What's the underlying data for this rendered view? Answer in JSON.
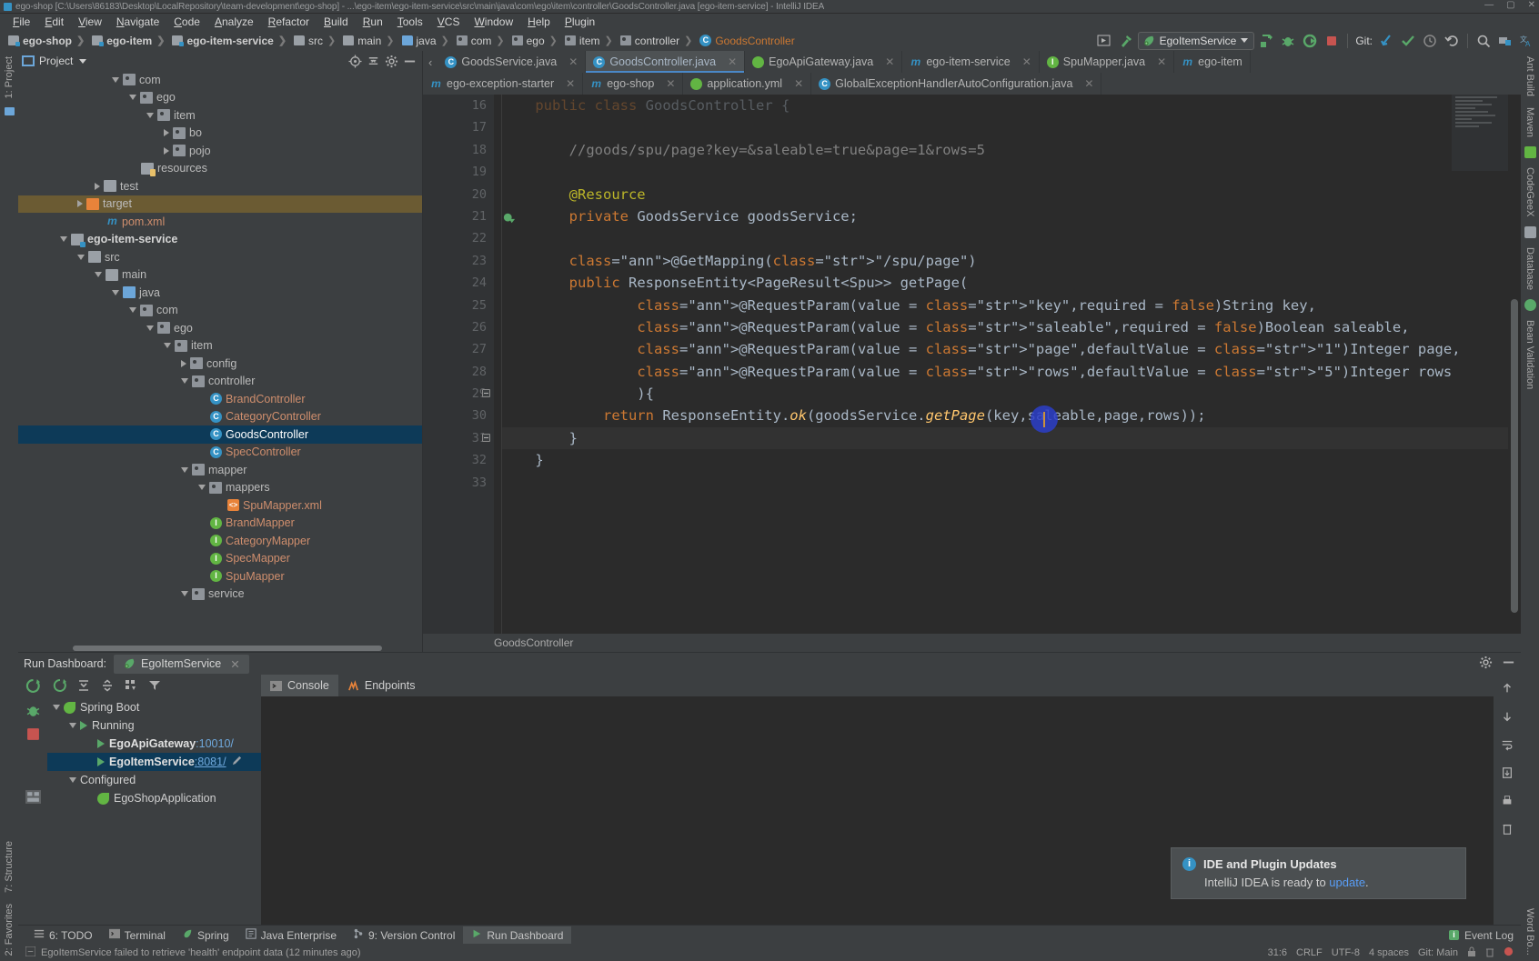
{
  "window": {
    "title": "ego-shop [C:\\Users\\86183\\Desktop\\LocalRepository\\team-development\\ego-shop] - ...\\ego-item\\ego-item-service\\src\\main\\java\\com\\ego\\item\\controller\\GoodsController.java [ego-item-service] - IntelliJ IDEA",
    "minimize": "—",
    "maximize": "▢",
    "close": "✕"
  },
  "menu": [
    "File",
    "Edit",
    "View",
    "Navigate",
    "Code",
    "Analyze",
    "Refactor",
    "Build",
    "Run",
    "Tools",
    "VCS",
    "Window",
    "Help",
    "Plugin"
  ],
  "breadcrumb": [
    {
      "label": "ego-shop",
      "icon": "module-folder-icon",
      "bold": true
    },
    {
      "label": "ego-item",
      "icon": "module-folder-icon",
      "bold": true
    },
    {
      "label": "ego-item-service",
      "icon": "module-folder-icon",
      "bold": true
    },
    {
      "label": "src",
      "icon": "folder-icon",
      "bold": false
    },
    {
      "label": "main",
      "icon": "folder-icon",
      "bold": false
    },
    {
      "label": "java",
      "icon": "source-folder-icon",
      "bold": false
    },
    {
      "label": "com",
      "icon": "package-icon",
      "bold": false
    },
    {
      "label": "ego",
      "icon": "package-icon",
      "bold": false
    },
    {
      "label": "item",
      "icon": "package-icon",
      "bold": false
    },
    {
      "label": "controller",
      "icon": "package-icon",
      "bold": false
    },
    {
      "label": "GoodsController",
      "icon": "class-icon",
      "bold": false,
      "active": true
    }
  ],
  "toolbar": {
    "run_config": "EgoItemService",
    "git_label": "Git:",
    "icons": [
      "preview-icon",
      "build-hammer-icon",
      "run-icon",
      "debug-icon",
      "run-coverage-icon",
      "stop-icon",
      "git-update-icon",
      "git-commit-icon",
      "git-history-icon",
      "undo-icon",
      "search-icon",
      "project-structure-icon",
      "translate-icon"
    ]
  },
  "left_strip": [
    "1: Project"
  ],
  "left_strip_bottom": [
    "7: Structure",
    "2: Favorites"
  ],
  "right_strip": [
    "Ant Build",
    "Maven",
    "CodeGeeX",
    "Database",
    "Bean Validation"
  ],
  "right_strip_bottom": [
    "Word Bo..."
  ],
  "project": {
    "title": "Project",
    "header_icons": [
      "locate-icon",
      "collapse-all-icon",
      "settings-gear-icon",
      "hide-icon"
    ],
    "tree": [
      {
        "indent": 5,
        "arrow": "down",
        "icon": "package-icon",
        "label": "com"
      },
      {
        "indent": 6,
        "arrow": "down",
        "icon": "package-icon",
        "label": "ego"
      },
      {
        "indent": 7,
        "arrow": "down",
        "icon": "package-icon",
        "label": "item"
      },
      {
        "indent": 8,
        "arrow": "right",
        "icon": "package-icon",
        "label": "bo"
      },
      {
        "indent": 8,
        "arrow": "right",
        "icon": "package-icon",
        "label": "pojo"
      },
      {
        "indent": 6,
        "arrow": "none",
        "icon": "resources-folder-icon",
        "label": "resources"
      },
      {
        "indent": 4,
        "arrow": "right",
        "icon": "folder-icon",
        "label": "test"
      },
      {
        "indent": 3,
        "arrow": "right",
        "icon": "target-folder-icon",
        "label": "target",
        "highlight": true
      },
      {
        "indent": 4,
        "arrow": "none",
        "icon": "maven-icon",
        "label": "pom.xml",
        "color": "red"
      },
      {
        "indent": 2,
        "arrow": "down",
        "icon": "module-folder-icon",
        "label": "ego-item-service",
        "bold": true
      },
      {
        "indent": 3,
        "arrow": "down",
        "icon": "folder-icon",
        "label": "src"
      },
      {
        "indent": 4,
        "arrow": "down",
        "icon": "folder-icon",
        "label": "main"
      },
      {
        "indent": 5,
        "arrow": "down",
        "icon": "source-folder-icon",
        "label": "java"
      },
      {
        "indent": 6,
        "arrow": "down",
        "icon": "package-icon",
        "label": "com"
      },
      {
        "indent": 7,
        "arrow": "down",
        "icon": "package-icon",
        "label": "ego"
      },
      {
        "indent": 8,
        "arrow": "down",
        "icon": "package-icon",
        "label": "item"
      },
      {
        "indent": 9,
        "arrow": "right",
        "icon": "package-icon",
        "label": "config"
      },
      {
        "indent": 9,
        "arrow": "down",
        "icon": "package-icon",
        "label": "controller"
      },
      {
        "indent": 10,
        "arrow": "none",
        "icon": "class-icon",
        "label": "BrandController",
        "color": "red"
      },
      {
        "indent": 10,
        "arrow": "none",
        "icon": "class-icon",
        "label": "CategoryController",
        "color": "red"
      },
      {
        "indent": 10,
        "arrow": "none",
        "icon": "class-icon",
        "label": "GoodsController",
        "selected": true
      },
      {
        "indent": 10,
        "arrow": "none",
        "icon": "class-icon",
        "label": "SpecController",
        "color": "red"
      },
      {
        "indent": 9,
        "arrow": "down",
        "icon": "package-icon",
        "label": "mapper"
      },
      {
        "indent": 10,
        "arrow": "down",
        "icon": "package-icon",
        "label": "mappers"
      },
      {
        "indent": 11,
        "arrow": "none",
        "icon": "xml-file-icon",
        "label": "SpuMapper.xml",
        "color": "red"
      },
      {
        "indent": 10,
        "arrow": "none",
        "icon": "interface-icon",
        "label": "BrandMapper",
        "color": "red"
      },
      {
        "indent": 10,
        "arrow": "none",
        "icon": "interface-icon",
        "label": "CategoryMapper",
        "color": "red"
      },
      {
        "indent": 10,
        "arrow": "none",
        "icon": "interface-icon",
        "label": "SpecMapper",
        "color": "red"
      },
      {
        "indent": 10,
        "arrow": "none",
        "icon": "interface-icon",
        "label": "SpuMapper",
        "color": "red"
      },
      {
        "indent": 9,
        "arrow": "down",
        "icon": "package-icon",
        "label": "service"
      }
    ]
  },
  "editor": {
    "tabs_row1": [
      {
        "label": "GoodsService.java",
        "icon": "class-icon",
        "close": "✕",
        "active": false
      },
      {
        "label": "GoodsController.java",
        "icon": "class-icon",
        "close": "✕",
        "active": true
      },
      {
        "label": "EgoApiGateway.java",
        "icon": "spring-class-icon",
        "close": "✕",
        "active": false
      },
      {
        "label": "ego-item-service",
        "icon": "maven-icon",
        "close": "✕",
        "active": false
      },
      {
        "label": "SpuMapper.java",
        "icon": "interface-icon",
        "close": "✕",
        "active": false
      },
      {
        "label": "ego-item",
        "icon": "maven-icon",
        "close": "",
        "active": false
      }
    ],
    "tabs_row2": [
      {
        "label": "ego-exception-starter",
        "icon": "maven-icon",
        "close": "✕",
        "active": false
      },
      {
        "label": "ego-shop",
        "icon": "maven-icon",
        "close": "✕",
        "active": false
      },
      {
        "label": "application.yml",
        "icon": "spring-yml-icon",
        "close": "✕",
        "active": false
      },
      {
        "label": "GlobalExceptionHandlerAutoConfiguration.java",
        "icon": "class-icon",
        "close": "✕",
        "active": false
      }
    ],
    "first_line_number": 16,
    "lines": [
      {
        "n": 16,
        "text": "    public class GoodsController {",
        "dim": true
      },
      {
        "n": 17,
        "text": ""
      },
      {
        "n": 18,
        "text": "        //goods/spu/page?key=&saleable=true&page=1&rows=5",
        "kind": "comment"
      },
      {
        "n": 19,
        "text": ""
      },
      {
        "n": 20,
        "text": "        @Resource",
        "kind": "annotation"
      },
      {
        "n": 21,
        "text": "        private GoodsService goodsService;",
        "gutter_icon": "run-bean-icon"
      },
      {
        "n": 22,
        "text": ""
      },
      {
        "n": 23,
        "text": "        @GetMapping(\"/spu/page\")"
      },
      {
        "n": 24,
        "text": "        public ResponseEntity<PageResult<Spu>> getPage("
      },
      {
        "n": 25,
        "text": "                @RequestParam(value = \"key\",required = false)String key,"
      },
      {
        "n": 26,
        "text": "                @RequestParam(value = \"saleable\",required = false)Boolean saleable,"
      },
      {
        "n": 27,
        "text": "                @RequestParam(value = \"page\",defaultValue = \"1\")Integer page,"
      },
      {
        "n": 28,
        "text": "                @RequestParam(value = \"rows\",defaultValue = \"5\")Integer rows"
      },
      {
        "n": 29,
        "text": "                ){",
        "fold": true
      },
      {
        "n": 30,
        "text": "            return ResponseEntity.ok(goodsService.getPage(key,saleable,page,rows));"
      },
      {
        "n": 31,
        "text": "        }",
        "fold": true,
        "current": true
      },
      {
        "n": 32,
        "text": "    }"
      },
      {
        "n": 33,
        "text": ""
      }
    ],
    "status_breadcrumb": "GoodsController"
  },
  "run_dashboard": {
    "title": "Run Dashboard:",
    "tab": "EgoItemService",
    "tab_close": "✕",
    "header_icons": [
      "settings-gear-icon",
      "hide-window-icon"
    ],
    "toolbar_icons": [
      "rerun-icon",
      "expand-all-icon",
      "collapse-all-icon",
      "group-icon",
      "filter-icon"
    ],
    "side_icons": [
      "rerun-icon",
      "debug-icon",
      "stop-icon",
      "dashboard-icon"
    ],
    "nodes": [
      {
        "indent": 0,
        "arrow": "down",
        "icon": "spring-boot-icon",
        "label": "Spring Boot"
      },
      {
        "indent": 1,
        "arrow": "down",
        "icon": "run-icon",
        "label": "Running"
      },
      {
        "indent": 2,
        "arrow": "none",
        "icon": "run-icon",
        "label": "EgoApiGateway",
        "port": ":10010/",
        "bold": true
      },
      {
        "indent": 2,
        "arrow": "none",
        "icon": "run-icon",
        "label": "EgoItemService",
        "port": ":8081/",
        "bold": true,
        "selected": true,
        "edit_icon": "edit-pencil-icon"
      },
      {
        "indent": 1,
        "arrow": "down",
        "icon": "none",
        "label": "Configured"
      },
      {
        "indent": 2,
        "arrow": "none",
        "icon": "spring-boot-icon",
        "label": "EgoShopApplication"
      }
    ],
    "console_tabs": [
      {
        "label": "Console",
        "icon": "console-icon",
        "active": true
      },
      {
        "label": "Endpoints",
        "icon": "endpoints-icon",
        "active": false
      }
    ],
    "rail_icons": [
      "scroll-up-icon",
      "scroll-down-icon",
      "soft-wrap-icon",
      "export-icon",
      "print-icon",
      "clear-all-icon"
    ]
  },
  "notification": {
    "icon": "info-icon",
    "title": "IDE and Plugin Updates",
    "body_prefix": "IntelliJ IDEA is ready to ",
    "link": "update",
    "body_suffix": "."
  },
  "tool_window_bar": [
    {
      "label": "6: TODO",
      "icon": "todo-icon",
      "active": false
    },
    {
      "label": "Terminal",
      "icon": "terminal-icon",
      "active": false
    },
    {
      "label": "Spring",
      "icon": "spring-icon",
      "active": false
    },
    {
      "label": "Java Enterprise",
      "icon": "java-enterprise-icon",
      "active": false
    },
    {
      "label": "9: Version Control",
      "icon": "version-control-icon",
      "active": false
    },
    {
      "label": "Run Dashboard",
      "icon": "run-icon",
      "active": true
    }
  ],
  "event_log": {
    "label": "Event Log",
    "icon": "event-log-icon"
  },
  "status": {
    "message": "EgoItemService failed to retrieve 'health' endpoint data (12 minutes ago)",
    "position": "31:6",
    "line_sep": "CRLF",
    "encoding": "UTF-8",
    "indent": "4 spaces",
    "branch": "Git: Main"
  },
  "colors": {
    "accent_blue": "#3592c4",
    "selection": "#0d3a58",
    "green": "#62b543",
    "orange": "#cc7832",
    "string_green": "#6a8759",
    "annotation_yellow": "#bbb529",
    "field_purple": "#9876aa",
    "method_yellow": "#ffc66d",
    "editor_bg": "#2b2b2b",
    "panel_bg": "#3c3f41"
  }
}
